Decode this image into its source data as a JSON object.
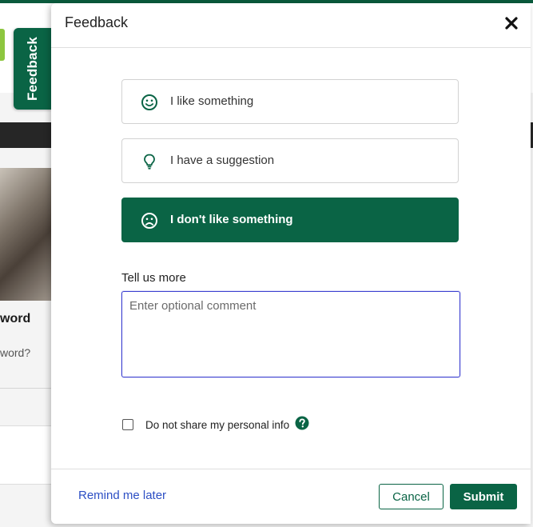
{
  "background": {
    "feedback_tab_label": "Feedback",
    "card_title_fragment": "word",
    "card_subtitle_fragment": "word?"
  },
  "panel": {
    "title": "Feedback",
    "close_icon": "close-icon",
    "options": [
      {
        "label": "I like something",
        "icon": "smile-icon",
        "selected": false
      },
      {
        "label": "I have a suggestion",
        "icon": "lightbulb-icon",
        "selected": false
      },
      {
        "label": "I don't like something",
        "icon": "frown-icon",
        "selected": true
      }
    ],
    "comment": {
      "label": "Tell us more",
      "placeholder": "Enter optional comment",
      "value": ""
    },
    "privacy": {
      "label": "Do not share my personal info",
      "checked": false,
      "help_icon": "question-circle-icon"
    },
    "footer": {
      "remind_label": "Remind me later",
      "cancel_label": "Cancel",
      "submit_label": "Submit"
    }
  },
  "colors": {
    "brand_green": "#0a6445",
    "link_blue": "#2d4fc4",
    "focus_blue": "#3b3fd0"
  }
}
